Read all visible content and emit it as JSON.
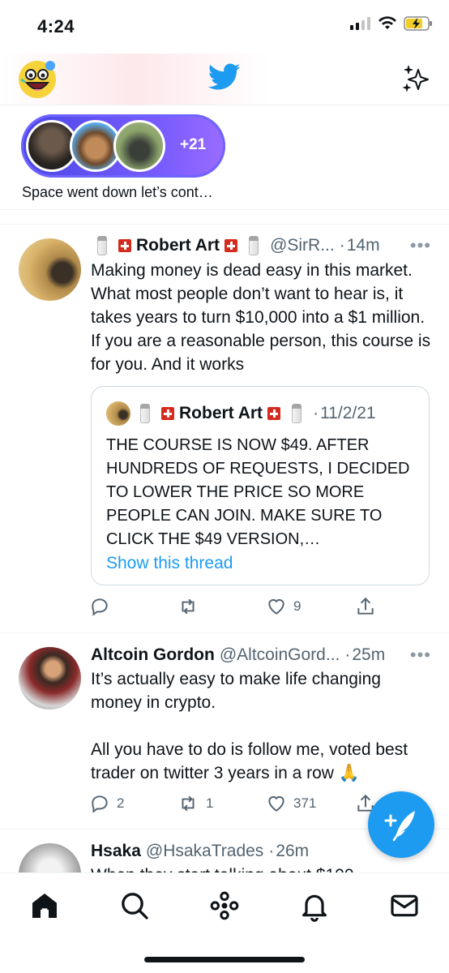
{
  "status_bar": {
    "time": "4:24"
  },
  "header": {
    "logo": "twitter-bird-icon",
    "sparkle": "sparkle-icon"
  },
  "spaces": {
    "extra_count": "+21",
    "caption": "Space went down let’s cont…"
  },
  "tweets": [
    {
      "name": "Robert Art",
      "handle": "@SirR...",
      "time": "14m",
      "text": "Making money is dead easy in this market. What most people don’t want to hear is, it takes years to turn $10,000 into a $1 million. If you are a reasonable person, this course is for you. And it works",
      "quote": {
        "name": "Robert Art",
        "date": "11/2/21",
        "text": "THE COURSE IS NOW $49. AFTER HUNDREDS OF REQUESTS, I DECIDED TO LOWER THE PRICE SO MORE PEOPLE CAN JOIN.  MAKE SURE TO CLICK THE $49 VERSION,…",
        "link": "Show this thread"
      },
      "replies": "",
      "retweets": "",
      "likes": "9"
    },
    {
      "name": "Altcoin Gordon",
      "handle": "@AltcoinGord...",
      "time": "25m",
      "text": "It’s actually easy to make life changing money in crypto.\n\nAll you have to do is follow me, voted best trader on twitter 3 years in a row 🙏",
      "replies": "2",
      "retweets": "1",
      "likes": "371"
    },
    {
      "name": "Hsaka",
      "handle": "@HsakaTrades",
      "time": "26m",
      "text": "When they start talking about $100"
    }
  ],
  "tab_bar": {
    "items": [
      "home-icon",
      "search-icon",
      "spaces-icon",
      "notifications-icon",
      "messages-icon"
    ]
  }
}
